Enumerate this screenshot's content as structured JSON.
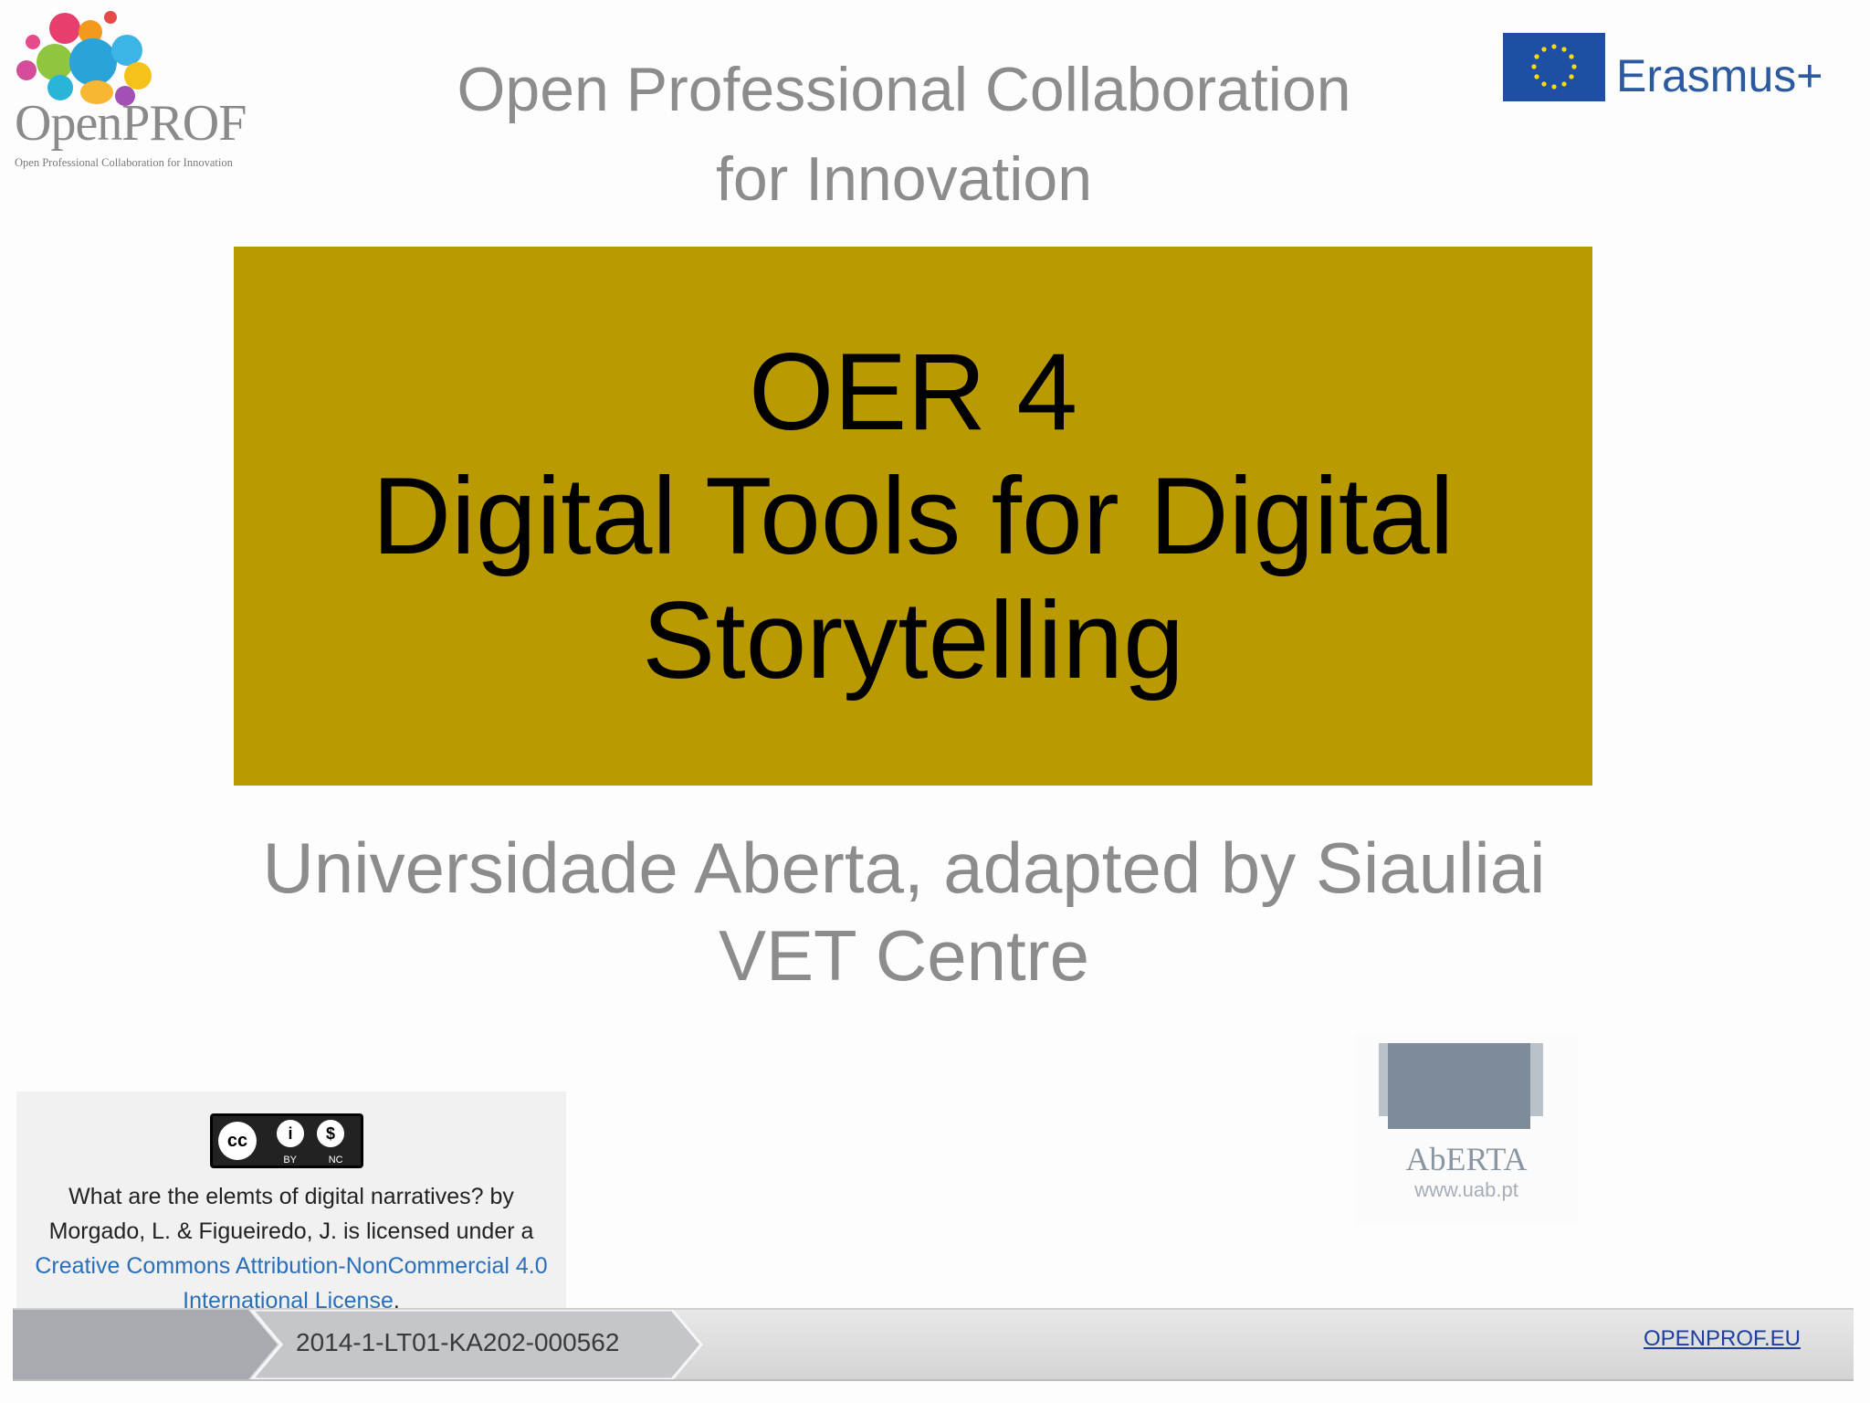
{
  "logo_openprof": {
    "word": "OpenPROF",
    "tagline": "Open Professional Collaboration for Innovation"
  },
  "header": {
    "line1": "Open Professional Collaboration",
    "line2": "for Innovation"
  },
  "logo_erasmus": {
    "word": "Erasmus+",
    "flag_color": "#1f4fa3",
    "text_color": "#2c5aa0"
  },
  "title_box": {
    "background": "#b99a00",
    "line1": "OER 4",
    "line2": "Digital Tools for Digital",
    "line3": "Storytelling"
  },
  "subtitle": {
    "line1": "Universidade Aberta, adapted by Siauliai",
    "line2": "VET Centre"
  },
  "license": {
    "badge_by": "BY",
    "badge_nc": "NC",
    "line1": "What are the elemts of digital narratives? by",
    "line2": "Morgado, L. & Figueiredo, J. is licensed under a",
    "link_line1": "Creative Commons Attribution-NonCommercial 4.0",
    "link_line2": "International License",
    "link_suffix": "."
  },
  "logo_aberta": {
    "word": "AbERTA",
    "url": "www.uab.pt"
  },
  "footer": {
    "project_code": "2014-1-LT01-KA202-000562",
    "link": "OPENPROF.EU"
  }
}
